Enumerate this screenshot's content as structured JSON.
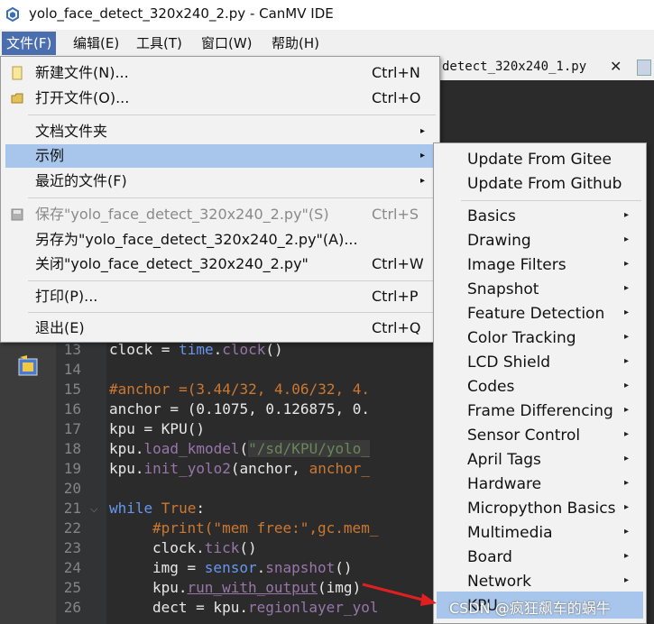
{
  "window": {
    "title": "yolo_face_detect_320x240_2.py - CanMV IDE"
  },
  "menubar": {
    "items": [
      "文件(F)",
      "编辑(E)",
      "工具(T)",
      "窗口(W)",
      "帮助(H)"
    ]
  },
  "tab": {
    "label": "detect_320x240_1.py",
    "close": "✕"
  },
  "file_menu": {
    "items": [
      {
        "label": "新建文件(N)...",
        "shortcut": "Ctrl+N"
      },
      {
        "label": "打开文件(O)...",
        "shortcut": "Ctrl+O"
      },
      {
        "label": "文档文件夹",
        "arrow": "▸"
      },
      {
        "label": "示例",
        "arrow": "▸"
      },
      {
        "label": "最近的文件(F)",
        "arrow": "▸"
      },
      {
        "label": "保存\"yolo_face_detect_320x240_2.py\"(S)",
        "shortcut": "Ctrl+S"
      },
      {
        "label": "另存为\"yolo_face_detect_320x240_2.py\"(A)...",
        "shortcut": ""
      },
      {
        "label": "关闭\"yolo_face_detect_320x240_2.py\"",
        "shortcut": "Ctrl+W"
      },
      {
        "label": "打印(P)...",
        "shortcut": "Ctrl+P"
      },
      {
        "label": "退出(E)",
        "shortcut": "Ctrl+Q"
      }
    ]
  },
  "examples_menu": {
    "items": [
      "Update From Gitee",
      "Update From Github",
      "Basics",
      "Drawing",
      "Image Filters",
      "Snapshot",
      "Feature Detection",
      "Color Tracking",
      "LCD Shield",
      "Codes",
      "Frame Differencing",
      "Sensor Control",
      "April Tags",
      "Hardware",
      "Micropython Basics",
      "Multimedia",
      "Board",
      "Network",
      "KPU"
    ],
    "arrow": "▸"
  },
  "editor": {
    "line_numbers": [
      "13",
      "14",
      "15",
      "16",
      "17",
      "18",
      "19",
      "20",
      "21",
      "22",
      "23",
      "24",
      "25",
      "26"
    ],
    "lines": {
      "l13": [
        "clock = ",
        "time",
        ".",
        "clock",
        "()"
      ],
      "l15": "#anchor =(3.44/32, 4.06/32, 4.",
      "l16": "anchor = (0.1075, 0.126875, 0.",
      "l17": "kpu = KPU()",
      "l18a": "kpu.",
      "l18b": "load_kmodel",
      "l18c": "(",
      "l18d": "\"/sd/KPU/yolo_",
      "l19a": "kpu.",
      "l19b": "init_yolo2",
      "l19c": "(anchor, ",
      "l19d": "anchor_",
      "l21a": "while",
      "l21b": " True",
      "l21c": ":",
      "l22": "#print(\"mem free:\",gc.mem_",
      "l23a": "clock.",
      "l23b": "tick",
      "l23c": "()",
      "l24a": "img = ",
      "l24b": "sensor",
      "l24c": ".",
      "l24d": "snapshot",
      "l24e": "()",
      "l25a": "kpu.",
      "l25b": "run_with_output",
      "l25c": "(img)",
      "l26a": "dect = kpu.",
      "l26b": "regionlayer_yol"
    }
  },
  "watermark": "CSDN @疯狂飙车的蜗牛"
}
